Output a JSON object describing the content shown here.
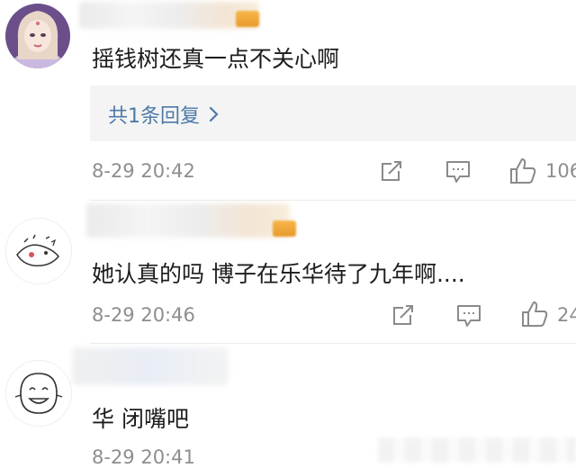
{
  "comments": [
    {
      "text": "摇钱树还真一点不关心啊",
      "reply_link": "共1条回复",
      "time": "8-29 20:42",
      "likes": "106"
    },
    {
      "text": "她认真的吗 博子在乐华待了九年啊....",
      "time": "8-29 20:46",
      "likes": "24"
    },
    {
      "text": "华 闭嘴吧",
      "time": "8-29 20:41"
    }
  ],
  "icons": {
    "share": "share-icon",
    "comment": "comment-icon",
    "like": "thumbs-up-icon",
    "chevron": "chevron-right-icon"
  },
  "colors": {
    "link": "#4d7aa8",
    "meta": "#8e8e8e",
    "reply_bg": "#f4f4f4",
    "icon": "#8a8a8a"
  }
}
